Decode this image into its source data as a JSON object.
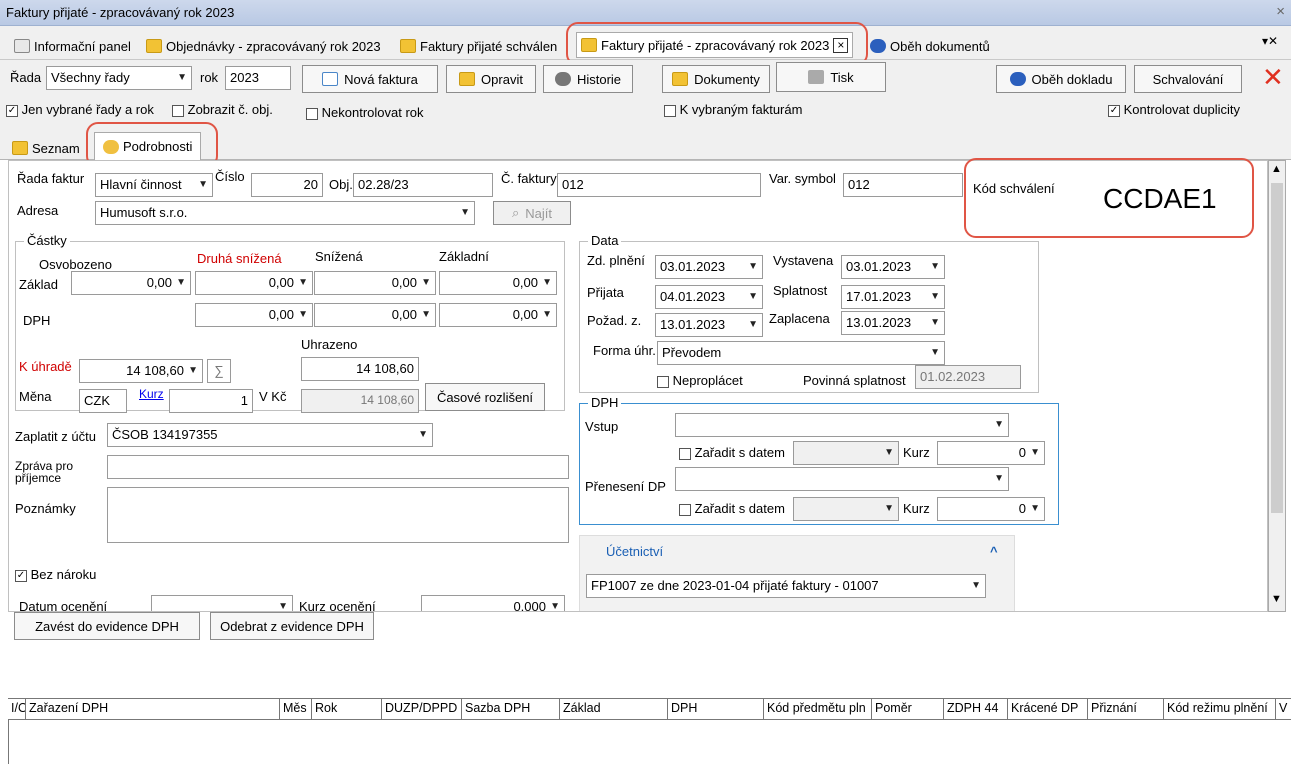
{
  "window": {
    "title": "Faktury přijaté - zpracovávaný rok 2023",
    "close": "×"
  },
  "doc_tabs": [
    {
      "label": "Informační panel"
    },
    {
      "label": "Objednávky - zpracovávaný rok 2023"
    },
    {
      "label": "Faktury přijaté schválen"
    },
    {
      "label": "Faktury přijaté - zpracovávaný rok 2023"
    },
    {
      "label": "Oběh dokumentů"
    }
  ],
  "toolbar": {
    "rada_label": "Řada",
    "rada_value": "Všechny řady",
    "rok_label": "rok",
    "rok_value": "2023",
    "nova_faktura": "Nová faktura",
    "opravit": "Opravit",
    "historie": "Historie",
    "dokumenty": "Dokumenty",
    "tisk": "Tisk",
    "obeh_dokladu": "Oběh dokladu",
    "schvalovani": "Schvalování",
    "jen_vybrane": "Jen vybrané řady a rok",
    "zobrazit_c_obj": "Zobrazit č. obj.",
    "nekontrolovat_rok": "Nekontrolovat rok",
    "k_vybranym": "K vybraným fakturám",
    "kontrolovat_duplicity": "Kontrolovat duplicity"
  },
  "sub_tabs": {
    "seznam": "Seznam",
    "podrobnosti": "Podrobnosti"
  },
  "header": {
    "rada_faktur_label": "Řada faktur",
    "rada_faktur_value": "Hlavní činnost",
    "cislo_label": "Číslo",
    "cislo_value": "20",
    "obj_label": "Obj.",
    "obj_value": "02.28/23",
    "c_faktury_label": "Č. faktury",
    "c_faktury_value": "012",
    "var_symbol_label": "Var. symbol",
    "var_symbol_value": "012",
    "kod_schvaleni_label": "Kód schválení",
    "kod_schvaleni_value": "CCDAE1",
    "adresa_label": "Adresa",
    "adresa_value": "Humusoft s.r.o.",
    "najit": "Najít"
  },
  "castky": {
    "title": "Částky",
    "cols": [
      "Osvobozeno",
      "Druhá snížená",
      "Snížená",
      "Základní"
    ],
    "zaklad_label": "Základ",
    "zaklad": [
      "0,00",
      "0,00",
      "0,00",
      "0,00"
    ],
    "dph_label": "DPH",
    "dph": [
      "0,00",
      "0,00",
      "0,00"
    ],
    "uhrazeno_label": "Uhrazeno",
    "uhrazeno_value": "14 108,60",
    "k_uhrade_label": "K úhradě",
    "k_uhrade_value": "14 108,60",
    "sigma": "∑",
    "mena_label": "Měna",
    "mena_value": "CZK",
    "kurz_label": "Kurz",
    "kurz_value": "1",
    "vkc_label": "V Kč",
    "vkc_value": "14 108,60",
    "casove_rozliseni": "Časové rozlišení"
  },
  "data_group": {
    "title": "Data",
    "zd_plneni_label": "Zd. plnění",
    "zd_plneni": "03.01.2023",
    "vystavena_label": "Vystavena",
    "vystavena": "03.01.2023",
    "prijata_label": "Přijata",
    "prijata": "04.01.2023",
    "splatnost_label": "Splatnost",
    "splatnost": "17.01.2023",
    "pozad_label": "Požad. z.",
    "pozad": "13.01.2023",
    "zaplacena_label": "Zaplacena",
    "zaplacena": "13.01.2023",
    "forma_label": "Forma úhr.",
    "forma_value": "Převodem",
    "neproplacet": "Neproplácet",
    "povinna_label": "Povinná splatnost",
    "povinna_value": "01.02.2023"
  },
  "dph_group": {
    "title": "DPH",
    "vstup_label": "Vstup",
    "zaradit": "Zařadit s datem",
    "kurz_label": "Kurz",
    "kurz_value": "0",
    "preneseni_label": "Přenesení DP"
  },
  "ucetnictvi": {
    "title": "Účetnictví",
    "chevron": "^",
    "doklad": "FP1007 ze dne 2023-01-04 přijaté faktury - 01007"
  },
  "lower_left": {
    "zaplatit_label": "Zaplatit z účtu",
    "zaplatit_value": "ČSOB 134197355",
    "zprava_label_1": "Zpráva pro",
    "zprava_label_2": "příjemce",
    "poznamky_label": "Poznámky",
    "bez_naroku": "Bez nároku",
    "datum_oceneni_label": "Datum ocenění",
    "kurz_oceneni_label": "Kurz ocenění",
    "kurz_oceneni_value": "0,000"
  },
  "dph_actions": {
    "zavest": "Zavést do evidence DPH",
    "odebrat": "Odebrat z evidence DPH"
  },
  "grid": {
    "columns": [
      "I/O",
      "Zařazení DPH",
      "Měs",
      "Rok",
      "DUZP/DPPD",
      "Sazba DPH",
      "Základ",
      "DPH",
      "Kód předmětu pln",
      "Poměr",
      "ZDPH 44",
      "Krácené DP",
      "Přiznání",
      "Kód režimu plnění",
      "V"
    ]
  },
  "colors": {
    "highlight": "#e05545",
    "link": "#0000ee",
    "required_label": "#d00000",
    "dph_border": "#3a8fd0"
  }
}
